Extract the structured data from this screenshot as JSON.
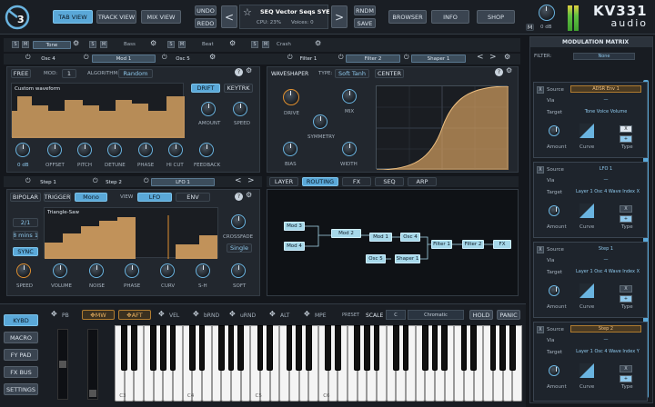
{
  "top": {
    "logo_num": "3",
    "tabs": [
      "TAB VIEW",
      "TRACK VIEW",
      "MIX VIEW"
    ],
    "undo": "UNDO",
    "redo": "REDO",
    "preset_name": "SEQ Vector Seqs SYE",
    "cpu": "CPU: 23%",
    "voices": "Voices: 0",
    "rndm": "RNDM",
    "save": "SAVE",
    "browser": "BROWSER",
    "info": "INFO",
    "shop": "SHOP",
    "vol_label": "0 dB",
    "m_label": "M",
    "brand1": "KV331",
    "brand2": "audio"
  },
  "layers": [
    {
      "s": "S",
      "m": "M",
      "name": "Tone"
    },
    {
      "s": "S",
      "m": "M",
      "name": "Bass"
    },
    {
      "s": "S",
      "m": "M",
      "name": "Beat"
    },
    {
      "s": "S",
      "m": "M",
      "name": "Crash"
    }
  ],
  "slots_row": [
    "Osc 4",
    "Mod 1",
    "Osc 5",
    "Filter 1",
    "Filter 2",
    "Shaper 1"
  ],
  "osc": {
    "free": "FREE",
    "mod": "MOD:",
    "mod_val": "1",
    "algo": "ALGORITHM:",
    "algo_val": "Random",
    "wave_name": "Custom waveform",
    "drift": "DRIFT",
    "keytrk": "KEYTRK",
    "amount": "AMOUNT",
    "speed": "SPEED",
    "knobs": [
      "0 dB",
      "OFFSET",
      "PITCH",
      "DETUNE",
      "PHASE",
      "HI CUT",
      "FEEDBACK"
    ]
  },
  "shaper": {
    "title": "WAVESHAPER",
    "type_lbl": "TYPE:",
    "type_val": "Soft Tanh",
    "center": "CENTER",
    "knobs": [
      "DRIVE",
      "MIX",
      "SYMMETRY",
      "BIAS",
      "WIDTH"
    ]
  },
  "slots_row2": [
    "Step 1",
    "Step 2",
    "LFO 1"
  ],
  "lfo": {
    "tabs": [
      "BIPOLAR",
      "TRIGGER",
      "Mono",
      "VIEW",
      "LFO",
      "ENV"
    ],
    "wave_name": "Triangle-Saw",
    "rate": "2/1",
    "rate2": "8 mins 1",
    "sync": "SYNC",
    "crossfade": "CROSSFADE",
    "cf_val": "Single",
    "knobs": [
      "SPEED",
      "VOLUME",
      "NOISE",
      "PHASE",
      "CURV",
      "S-H",
      "SOFT"
    ]
  },
  "routing": {
    "tabs": [
      "LAYER",
      "ROUTING",
      "FX",
      "SEQ",
      "ARP"
    ],
    "nodes": [
      "Mod 3",
      "Mod 4",
      "Mod 2",
      "Mod 1",
      "Osc 4",
      "Osc 5",
      "Shaper 1",
      "Filter 1",
      "Filter 2",
      "FX"
    ]
  },
  "matrix": {
    "title": "MODULATION MATRIX",
    "filter_lbl": "FILTER:",
    "filter_val": "None",
    "cards": [
      {
        "source": "ADSR Env 1",
        "via": "—",
        "target": "Tone Voice Volume",
        "amount": "Amount",
        "curve": "Curve",
        "type": "Type"
      },
      {
        "source": "LFO 1",
        "via": "—",
        "target": "Layer 1 Osc 4 Wave Index X",
        "amount": "Amount",
        "curve": "Curve",
        "type": "Type"
      },
      {
        "source": "Step 1",
        "via": "—",
        "target": "Layer 1 Osc 4 Wave Index X",
        "amount": "Amount",
        "curve": "Curve",
        "type": "Type"
      },
      {
        "source": "Step 2",
        "via": "—",
        "target": "Layer 1 Osc 4 Wave Index Y",
        "amount": "Amount",
        "curve": "Curve",
        "type": "Type"
      }
    ],
    "lbl_source": "Source",
    "lbl_via": "Via",
    "lbl_target": "Target",
    "x": "X"
  },
  "bottom": {
    "side_btns": [
      "KYBD",
      "MACRO",
      "FY PAD",
      "FX BUS",
      "SETTINGS"
    ],
    "pb": "PB",
    "mw": "MW",
    "aft": "AFT",
    "vel": "VEL",
    "brnd": "bRND",
    "urnd": "uRND",
    "alt": "ALT",
    "mpe": "MPE",
    "preset_lbl": "PRESET",
    "scale_lbl": "SCALE",
    "scale_key": "C",
    "scale_val": "Chromatic",
    "hold": "HOLD",
    "panic": "PANIC",
    "octaves": [
      "C3",
      "C4",
      "C5",
      "C6"
    ]
  }
}
